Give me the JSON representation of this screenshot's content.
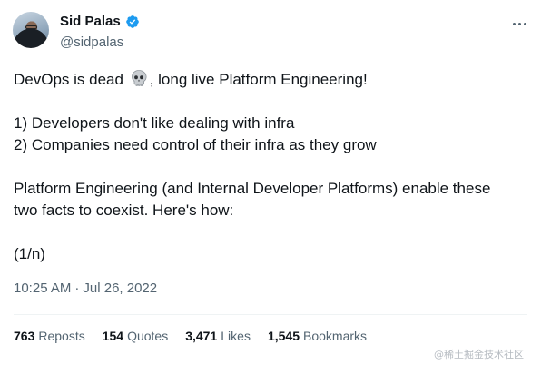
{
  "author": {
    "display_name": "Sid Palas",
    "handle": "@sidpalas",
    "verified_icon": "verified-badge-icon",
    "avatar_icon": "avatar"
  },
  "tweet": {
    "line1_before": "DevOps is dead",
    "line1_emoji": "skull-icon",
    "line1_after": ", long live Platform Engineering!",
    "line2": "1) Developers don't like dealing with infra",
    "line3": "2) Companies need control of their infra as they grow",
    "line4": "Platform Engineering (and Internal Developer Platforms) enable these",
    "line5": "two facts to coexist. Here's how:",
    "line6": "(1/n)"
  },
  "meta": {
    "time": "10:25 AM",
    "separator": "·",
    "date": "Jul 26, 2022"
  },
  "stats": {
    "reposts_count": "763",
    "reposts_label": "Reposts",
    "quotes_count": "154",
    "quotes_label": "Quotes",
    "likes_count": "3,471",
    "likes_label": "Likes",
    "bookmarks_count": "1,545",
    "bookmarks_label": "Bookmarks"
  },
  "watermark": "@稀土掘金技术社区",
  "colors": {
    "text": "#0f1419",
    "secondary": "#536471",
    "verified": "#1d9bf0",
    "divider": "#eff3f4"
  }
}
